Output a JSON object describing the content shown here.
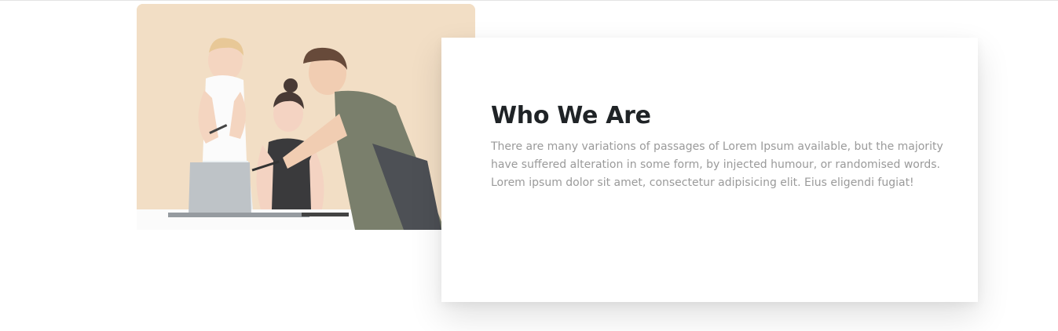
{
  "about": {
    "image": {
      "subject": "three-people-with-laptop-photo"
    },
    "title": "Who We Are",
    "description": "There are many variations of passages of Lorem Ipsum available, but the majority have suffered alteration in some form, by injected humour, or randomised words. Lorem ipsum dolor sit amet, consectetur adipisicing elit. Eius eligendi fugiat!"
  },
  "colors": {
    "photo_background": "#f1dcc0",
    "title": "#1f2326",
    "body_text": "#9a9a9a",
    "card_background": "#ffffff"
  }
}
